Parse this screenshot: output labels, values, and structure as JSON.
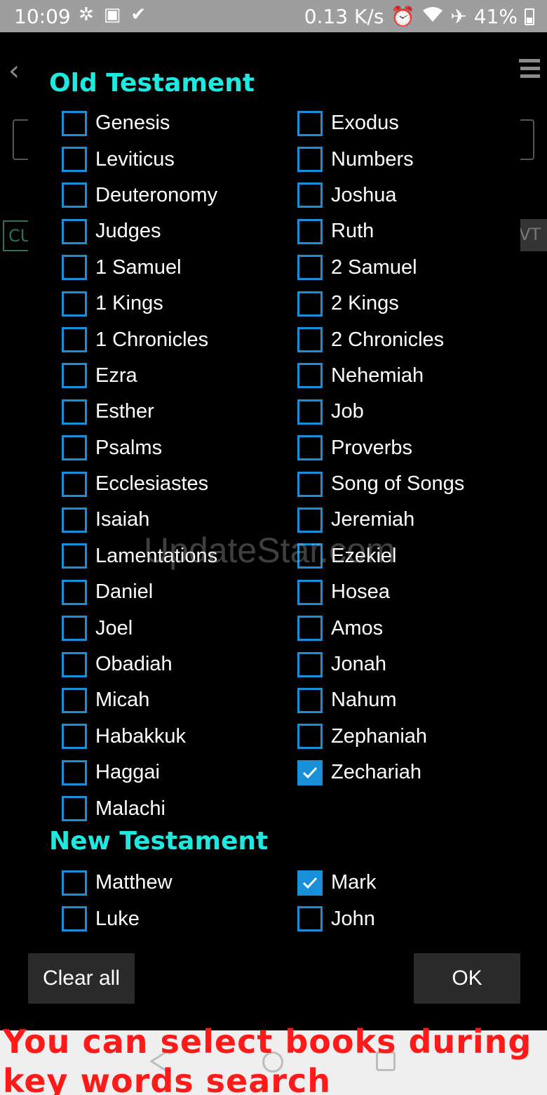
{
  "status_bar": {
    "time": "10:09",
    "left_icons": [
      "butterfly-icon",
      "photo-icon",
      "checkmark-icon"
    ],
    "net_speed": "0.13 K/s",
    "right_icons": [
      "alarm-icon",
      "wifi-icon",
      "airplane-icon"
    ],
    "battery": "41%"
  },
  "background_app": {
    "back_icon": "chevron-left-icon",
    "menu_icon": "menu-icon",
    "left_chip": "CU",
    "right_chip": "VT"
  },
  "dialog": {
    "old_testament": {
      "title": "Old Testament",
      "books": [
        {
          "name": "Genesis",
          "checked": false
        },
        {
          "name": "Exodus",
          "checked": false
        },
        {
          "name": "Leviticus",
          "checked": false
        },
        {
          "name": "Numbers",
          "checked": false
        },
        {
          "name": "Deuteronomy",
          "checked": false
        },
        {
          "name": "Joshua",
          "checked": false
        },
        {
          "name": "Judges",
          "checked": false
        },
        {
          "name": "Ruth",
          "checked": false
        },
        {
          "name": "1 Samuel",
          "checked": false
        },
        {
          "name": "2 Samuel",
          "checked": false
        },
        {
          "name": "1 Kings",
          "checked": false
        },
        {
          "name": "2 Kings",
          "checked": false
        },
        {
          "name": "1 Chronicles",
          "checked": false
        },
        {
          "name": "2 Chronicles",
          "checked": false
        },
        {
          "name": "Ezra",
          "checked": false
        },
        {
          "name": "Nehemiah",
          "checked": false
        },
        {
          "name": "Esther",
          "checked": false
        },
        {
          "name": "Job",
          "checked": false
        },
        {
          "name": "Psalms",
          "checked": false
        },
        {
          "name": "Proverbs",
          "checked": false
        },
        {
          "name": "Ecclesiastes",
          "checked": false
        },
        {
          "name": "Song of Songs",
          "checked": false
        },
        {
          "name": "Isaiah",
          "checked": false
        },
        {
          "name": "Jeremiah",
          "checked": false
        },
        {
          "name": "Lamentations",
          "checked": false
        },
        {
          "name": "Ezekiel",
          "checked": false
        },
        {
          "name": "Daniel",
          "checked": false
        },
        {
          "name": "Hosea",
          "checked": false
        },
        {
          "name": "Joel",
          "checked": false
        },
        {
          "name": "Amos",
          "checked": false
        },
        {
          "name": "Obadiah",
          "checked": false
        },
        {
          "name": "Jonah",
          "checked": false
        },
        {
          "name": "Micah",
          "checked": false
        },
        {
          "name": "Nahum",
          "checked": false
        },
        {
          "name": "Habakkuk",
          "checked": false
        },
        {
          "name": "Zephaniah",
          "checked": false
        },
        {
          "name": "Haggai",
          "checked": false
        },
        {
          "name": "Zechariah",
          "checked": true
        },
        {
          "name": "Malachi",
          "checked": false
        }
      ]
    },
    "new_testament": {
      "title": "New Testament",
      "books": [
        {
          "name": "Matthew",
          "checked": false
        },
        {
          "name": "Mark",
          "checked": true
        },
        {
          "name": "Luke",
          "checked": false
        },
        {
          "name": "John",
          "checked": false
        }
      ]
    },
    "clear_all_label": "Clear all",
    "ok_label": "OK"
  },
  "watermark": "UpdateStar.com",
  "caption": "You can select books during key words search",
  "colors": {
    "section_title": "#1de9e0",
    "checkbox": "#1a8fd9",
    "caption": "#ff1a1a"
  }
}
